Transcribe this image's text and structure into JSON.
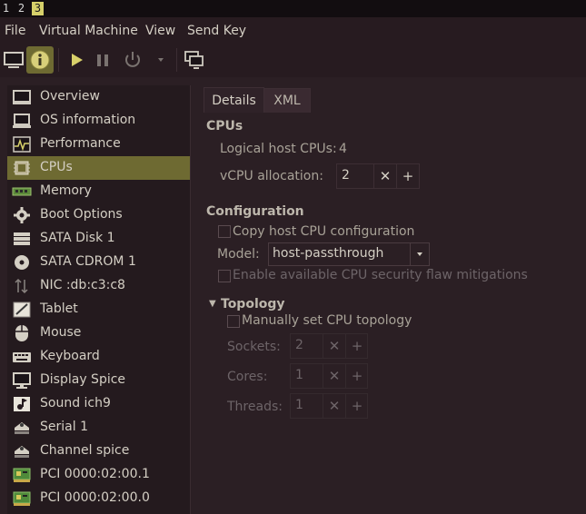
{
  "workspaces": [
    "1",
    "2",
    "3"
  ],
  "active_workspace": "3",
  "menu": [
    "File",
    "Virtual Machine",
    "View",
    "Send Key"
  ],
  "toolbar": {
    "console_icon": "monitor-icon",
    "details_icon": "info-icon",
    "run_icon": "play-icon",
    "pause_icon": "pause-icon",
    "shutdown_icon": "power-icon",
    "shutdown_menu_icon": "chevron-down-icon",
    "fullscreen_icon": "screens-icon"
  },
  "sidebar": {
    "selected": "CPUs",
    "items": [
      {
        "label": "Overview",
        "icon": "monitor-icon"
      },
      {
        "label": "OS information",
        "icon": "laptop-icon"
      },
      {
        "label": "Performance",
        "icon": "performance-chart-icon"
      },
      {
        "label": "CPUs",
        "icon": "cpu-chip-icon"
      },
      {
        "label": "Memory",
        "icon": "memory-stick-icon"
      },
      {
        "label": "Boot Options",
        "icon": "gear-icon"
      },
      {
        "label": "SATA Disk 1",
        "icon": "hard-disk-icon"
      },
      {
        "label": "SATA CDROM 1",
        "icon": "cdrom-icon"
      },
      {
        "label": "NIC :db:c3:c8",
        "icon": "network-arrows-icon"
      },
      {
        "label": "Tablet",
        "icon": "tablet-icon"
      },
      {
        "label": "Mouse",
        "icon": "mouse-icon"
      },
      {
        "label": "Keyboard",
        "icon": "keyboard-icon"
      },
      {
        "label": "Display Spice",
        "icon": "display-icon"
      },
      {
        "label": "Sound ich9",
        "icon": "sound-icon"
      },
      {
        "label": "Serial 1",
        "icon": "serial-icon"
      },
      {
        "label": "Channel spice",
        "icon": "channel-icon"
      },
      {
        "label": "PCI 0000:02:00.1",
        "icon": "pci-card-icon"
      },
      {
        "label": "PCI 0000:02:00.0",
        "icon": "pci-card-icon"
      }
    ]
  },
  "tabs": [
    "Details",
    "XML"
  ],
  "active_tab": "Details",
  "cpus": {
    "heading": "CPUs",
    "logical_label": "Logical host CPUs:",
    "logical_value": "4",
    "vcpu_label": "vCPU allocation:",
    "vcpu_value": "2"
  },
  "configuration": {
    "heading": "Configuration",
    "copy_host_label": "Copy host CPU configuration",
    "copy_host_checked": false,
    "model_label": "Model:",
    "model_value": "host-passthrough",
    "mitigations_label": "Enable available CPU security flaw mitigations",
    "mitigations_checked": false
  },
  "topology": {
    "heading": "Topology",
    "manual_label": "Manually set CPU topology",
    "manual_checked": false,
    "sockets_label": "Sockets:",
    "sockets_value": "2",
    "cores_label": "Cores:",
    "cores_value": "1",
    "threads_label": "Threads:",
    "threads_value": "1"
  },
  "spin_minus": "✕",
  "spin_plus": "+",
  "colors": {
    "background": "#2b1f24",
    "selection": "#6e6a32",
    "text": "#d4cfc4",
    "workspace_active": "#d6d06a"
  }
}
